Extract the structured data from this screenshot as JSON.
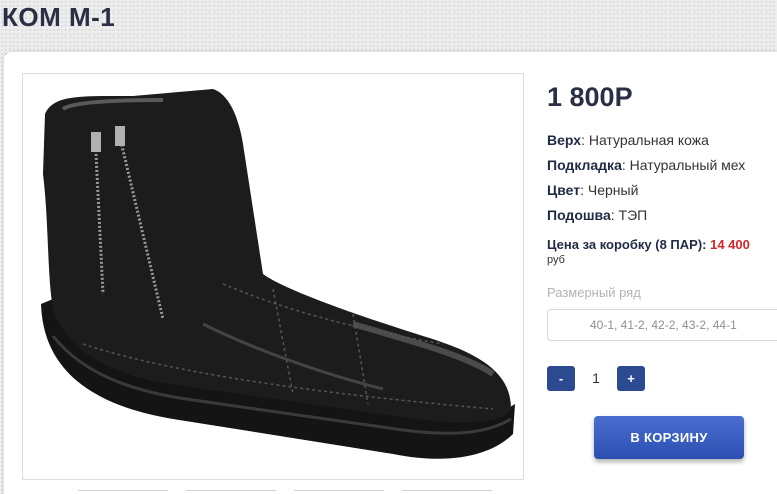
{
  "product": {
    "title": "КОМ М-1",
    "price": "1 800Р",
    "specs": [
      {
        "label": "Верх",
        "value": ": Натуральная кожа"
      },
      {
        "label": "Подкладка",
        "value": ": Натуральный мех"
      },
      {
        "label": "Цвет",
        "value": ": Черный"
      },
      {
        "label": "Подошва",
        "value": ": ТЭП"
      }
    ],
    "box_price_label": "Цена за коробку (8 ПАР): ",
    "box_price_value": "14 400",
    "box_price_unit": "руб",
    "size_range_label": "Размерный ряд",
    "size_range_value": "40-1, 41-2, 42-2, 43-2, 44-1",
    "image_icon": "boot-photo-icon"
  },
  "quantity": {
    "minus_label": "-",
    "value": "1",
    "plus_label": "+"
  },
  "cart": {
    "button_label": "В КОРЗИНУ"
  },
  "colors": {
    "accent": "#2c4a8f",
    "price_red": "#d3262a",
    "title": "#2a2f45"
  }
}
